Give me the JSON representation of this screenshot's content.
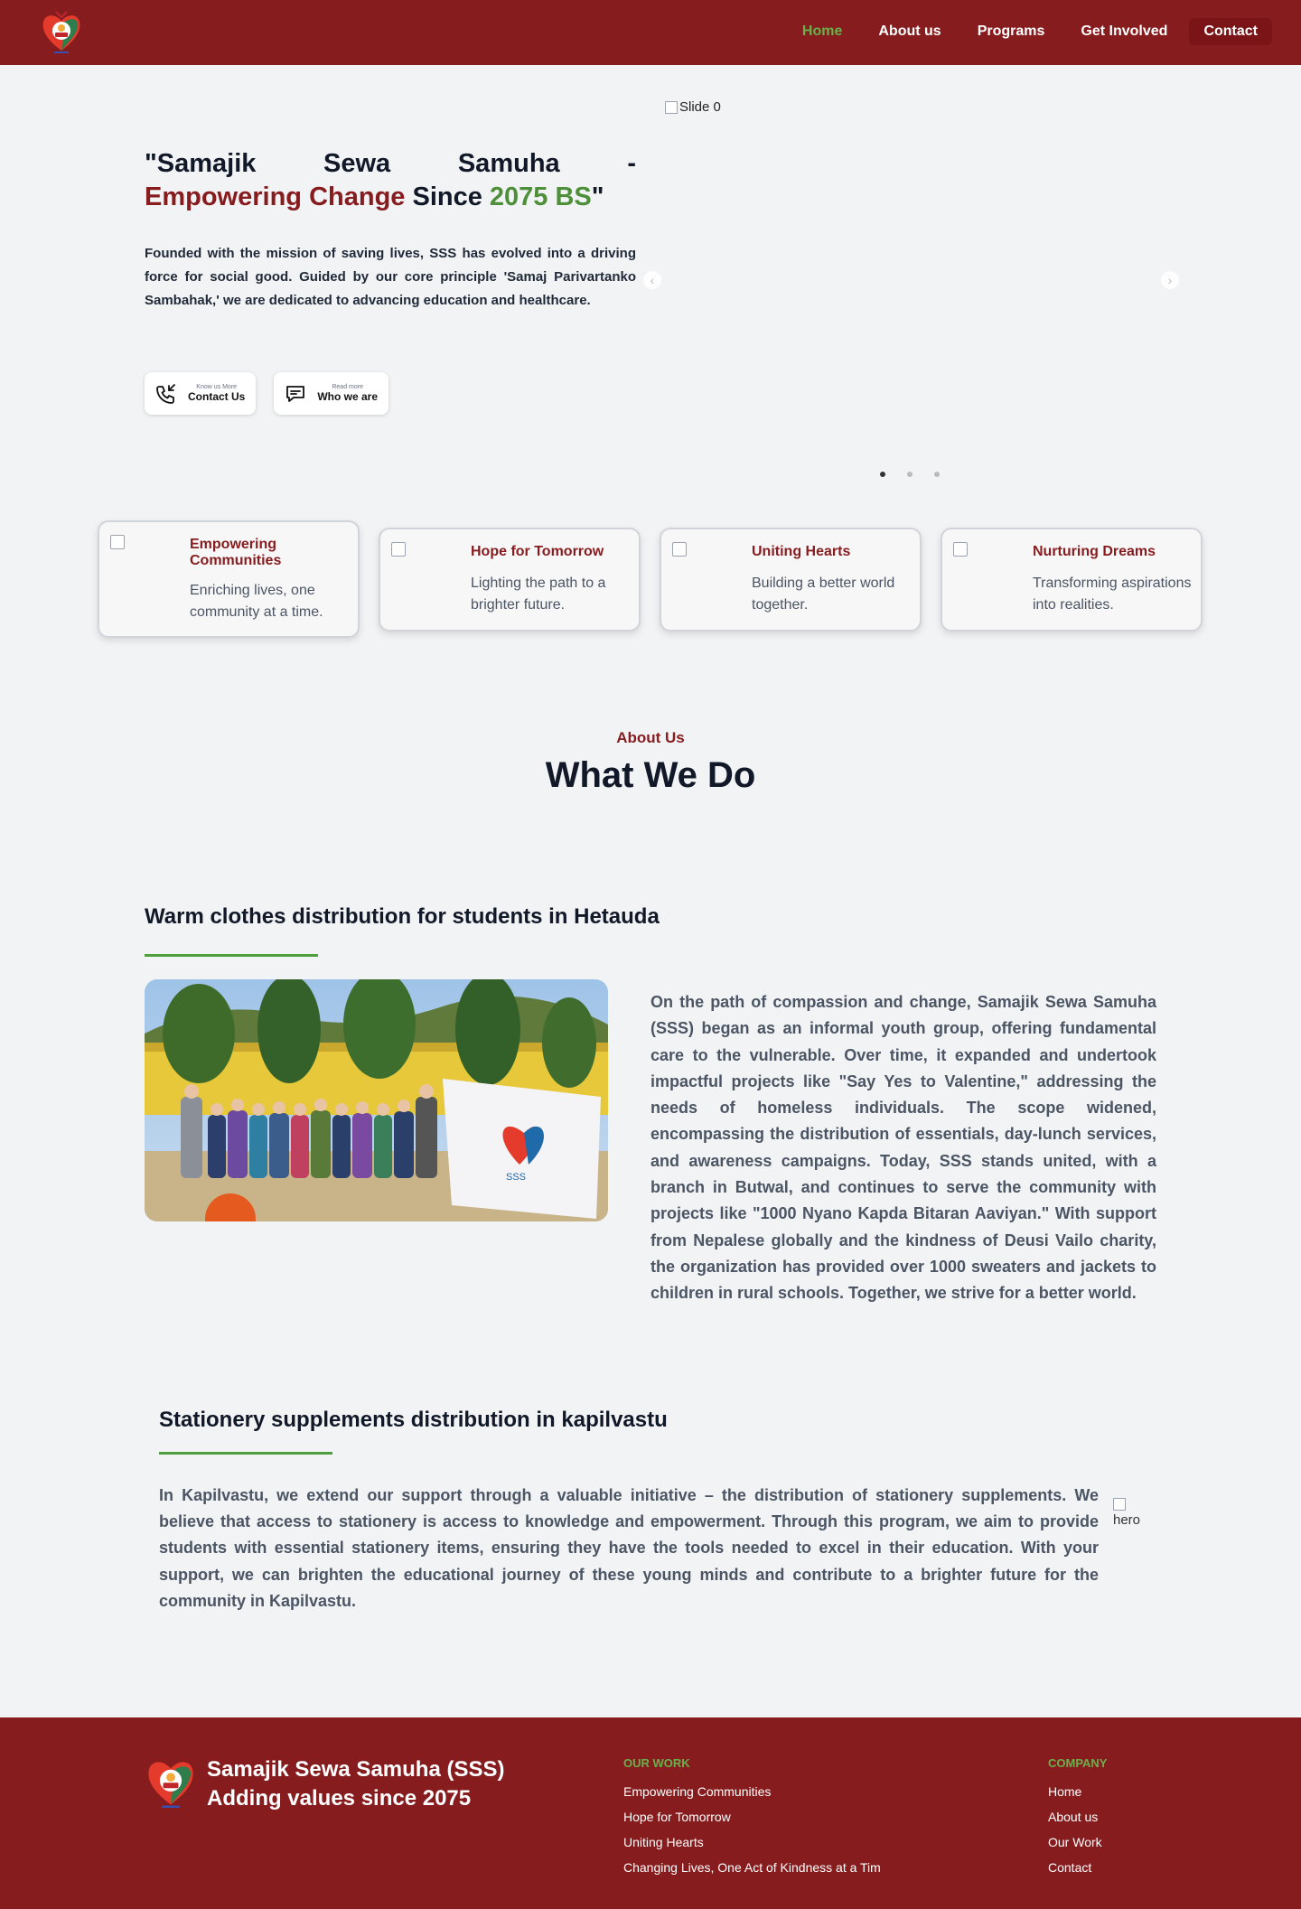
{
  "nav": {
    "links": [
      "Home",
      "About us",
      "Programs",
      "Get Involved",
      "Contact"
    ]
  },
  "hero": {
    "title_w1": "\"Samajik",
    "title_w2": "Sewa",
    "title_w3": "Samuha",
    "title_w4": "-",
    "title_red": "Empowering Change",
    "title_mid": " Since ",
    "title_green": "2075 BS",
    "title_end": "\"",
    "description": "Founded with the mission of saving lives, SSS has evolved into a driving force for social good. Guided by our core principle 'Samaj Parivartanko Sambahak,' we are dedicated to advancing education and healthcare.",
    "btn1_small": "Know us More",
    "btn1_big": "Contact Us",
    "btn2_small": "Read more",
    "btn2_big": "Who we are",
    "slide_alt": "Slide 0",
    "prev_glyph": "‹",
    "next_glyph": "›"
  },
  "cards": [
    {
      "title": "Empowering Communities",
      "desc": "Enriching lives, one community at a time."
    },
    {
      "title": "Hope for Tomorrow",
      "desc": "Lighting the path to a brighter future."
    },
    {
      "title": "Uniting Hearts",
      "desc": "Building a better world together."
    },
    {
      "title": "Nurturing Dreams",
      "desc": "Transforming aspirations into realities."
    }
  ],
  "about": {
    "kicker": "About Us",
    "title": "What We Do"
  },
  "section1": {
    "title": "Warm clothes distribution for students in Hetauda",
    "text": "On the path of compassion and change, Samajik Sewa Samuha (SSS) began as an informal youth group, offering fundamental care to the vulnerable. Over time, it expanded and undertook impactful projects like \"Say Yes to Valentine,\" addressing the needs of homeless individuals. The scope widened, encompassing the distribution of essentials, day-lunch services, and awareness campaigns. Today, SSS stands united, with a branch in Butwal, and continues to serve the community with projects like \"1000 Nyano Kapda Bitaran Aaviyan.\" With support from Nepalese globally and the kindness of Deusi Vailo charity, the organization has provided over 1000 sweaters and jackets to children in rural schools. Together, we strive for a better world."
  },
  "section2": {
    "title": "Stationery supplements distribution in kapilvastu",
    "text": "In Kapilvastu, we extend our support through a valuable initiative – the distribution of stationery supplements. We believe that access to stationery is access to knowledge and empowerment. Through this program, we aim to provide students with essential stationery items, ensuring they have the tools needed to excel in their education. With your support, we can brighten the educational journey of these young minds and contribute to a brighter future for the community in Kapilvastu.",
    "image_alt": "hero"
  },
  "footer": {
    "brand_line1": "Samajik Sewa Samuha (SSS)",
    "brand_line2": "Adding values since 2075",
    "work_heading": "OUR WORK",
    "work_items": [
      "Empowering Communities",
      "Hope for Tomorrow",
      "Uniting Hearts",
      "Changing Lives, One Act of Kindness at a Tim"
    ],
    "company_heading": "COMPANY",
    "company_items": [
      "Home",
      "About us",
      "Our Work",
      "Contact"
    ]
  },
  "colors": {
    "brand_red": "#861c1e",
    "accent_green": "#4e8f3a",
    "background": "#f2f3f5"
  },
  "icons": [
    "logo-heart-icon",
    "phone-icon",
    "chat-icon",
    "broken-image-icon",
    "chevron-left-icon",
    "chevron-right-icon"
  ]
}
